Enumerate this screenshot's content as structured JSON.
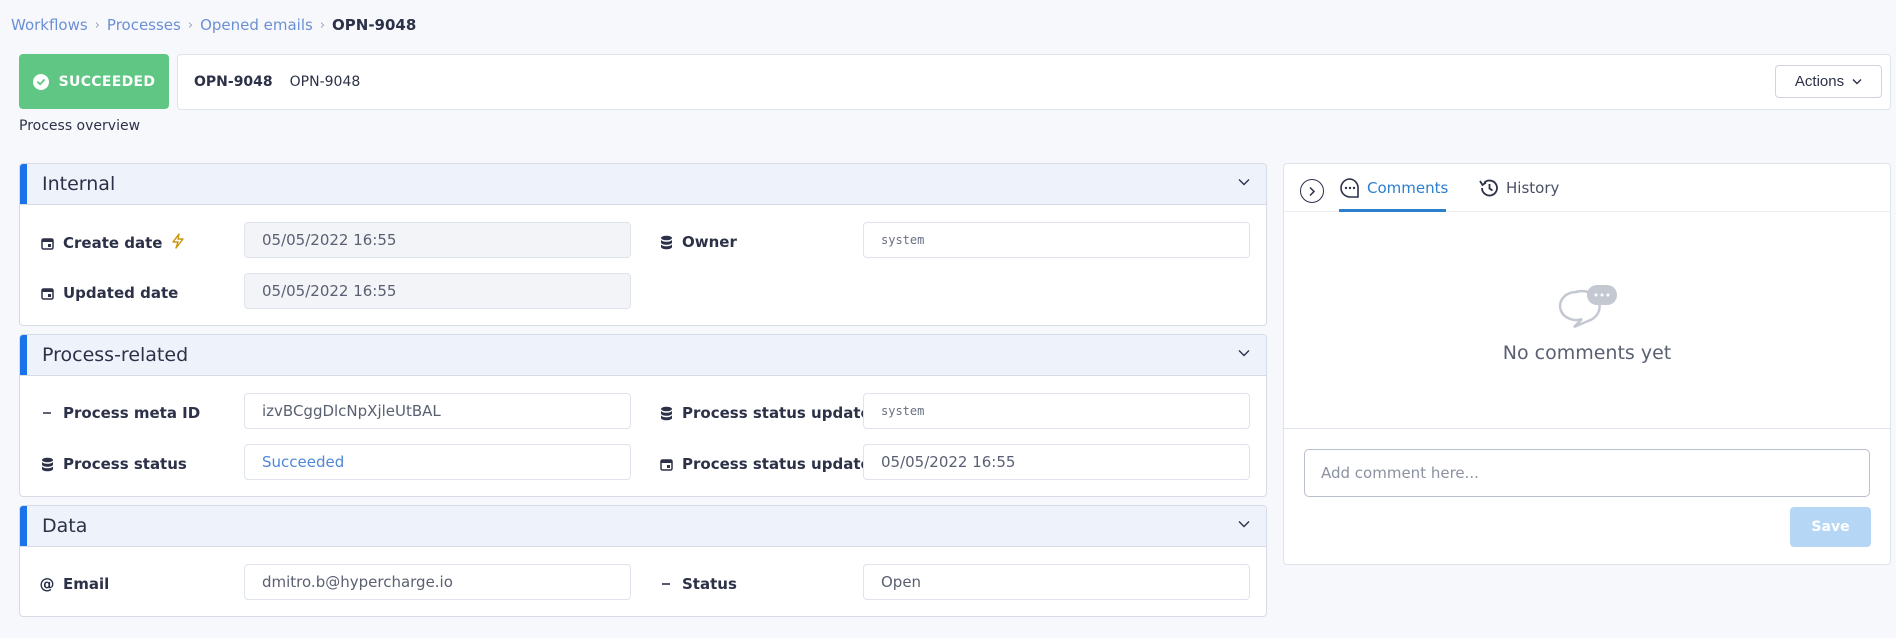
{
  "breadcrumb": {
    "items": [
      "Workflows",
      "Processes",
      "Opened emails"
    ],
    "current": "OPN-9048",
    "separator": "›"
  },
  "header": {
    "status": "SUCCEEDED",
    "status_color": "#5fc783",
    "id_primary": "OPN-9048",
    "id_secondary": "OPN-9048",
    "actions_label": "Actions",
    "overview_label": "Process overview"
  },
  "sections": {
    "internal": {
      "title": "Internal",
      "create_date_label": "Create date",
      "create_date_value": "05/05/2022 16:55",
      "owner_label": "Owner",
      "owner_value": "system",
      "updated_date_label": "Updated date",
      "updated_date_value": "05/05/2022 16:55"
    },
    "process_related": {
      "title": "Process-related",
      "meta_id_label": "Process meta ID",
      "meta_id_value": "izvBCggDlcNpXjleUtBAL",
      "status_updated_by_label": "Process status update...",
      "status_updated_by_value": "system",
      "status_label": "Process status",
      "status_value": "Succeeded",
      "status_updated_at_label": "Process status update...",
      "status_updated_at_value": "05/05/2022 16:55"
    },
    "data": {
      "title": "Data",
      "email_label": "Email",
      "email_value": "dmitro.b@hypercharge.io",
      "status_label": "Status",
      "status_value": "Open"
    }
  },
  "side_panel": {
    "tabs": [
      {
        "label": "Comments",
        "icon": "comment-icon",
        "active": true
      },
      {
        "label": "History",
        "icon": "history-icon",
        "active": false
      }
    ],
    "empty_text": "No comments yet",
    "comment_placeholder": "Add comment here...",
    "save_label": "Save"
  },
  "colors": {
    "accent": "#1a73e8",
    "link": "#6b8fd6",
    "success": "#5fc783"
  }
}
